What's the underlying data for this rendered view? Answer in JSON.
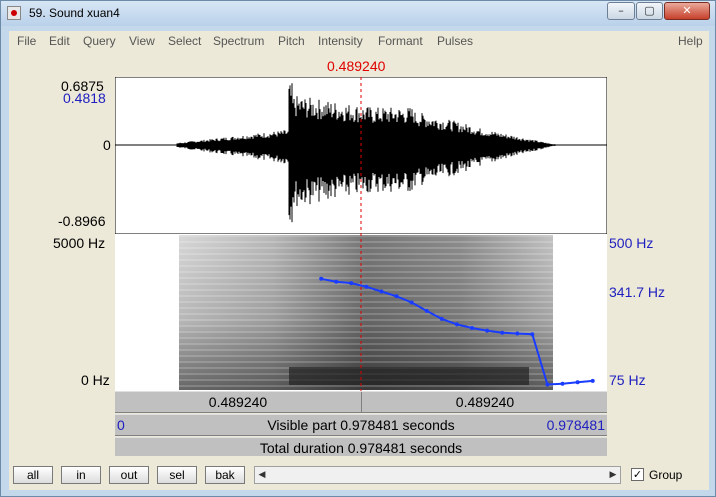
{
  "window": {
    "title": "59. Sound xuan4",
    "controls": [
      "minimize",
      "maximize",
      "close"
    ]
  },
  "menubar": {
    "items": [
      "File",
      "Edit",
      "Query",
      "View",
      "Select",
      "Spectrum",
      "Pitch",
      "Intensity",
      "Formant",
      "Pulses"
    ],
    "help": "Help"
  },
  "cursor_time": "0.489240",
  "waveform": {
    "max_label": "0.6875",
    "cursor_amp_label": "0.4818",
    "zero_label": "0",
    "min_label": "-0.8966"
  },
  "spectrogram": {
    "top_label": "5000 Hz",
    "bottom_label": "0 Hz"
  },
  "pitch_axis": {
    "top_label": "500 Hz",
    "mid_label": "341.7 Hz",
    "bottom_label": "75 Hz"
  },
  "time_bar": {
    "left": "0.489240",
    "right": "0.489240"
  },
  "visible_bar": {
    "start": "0",
    "text": "Visible part 0.978481 seconds",
    "end": "0.978481"
  },
  "total_bar": {
    "text": "Total duration 0.978481 seconds"
  },
  "nav_buttons": [
    "all",
    "in",
    "out",
    "sel",
    "bak"
  ],
  "group": {
    "label": "Group",
    "checked": true
  },
  "colors": {
    "cursor": "#e00000",
    "pitch": "#1a3cff",
    "axis_text": "#2020c0"
  },
  "pitch_track": {
    "time_s": [
      0.41,
      0.44,
      0.47,
      0.5,
      0.53,
      0.56,
      0.59,
      0.62,
      0.65,
      0.68,
      0.71,
      0.74,
      0.77,
      0.8,
      0.83,
      0.86,
      0.89,
      0.92,
      0.95
    ],
    "hz": [
      380,
      372,
      368,
      358,
      345,
      332,
      315,
      292,
      270,
      255,
      245,
      238,
      232,
      230,
      228,
      90,
      92,
      96,
      100
    ]
  }
}
